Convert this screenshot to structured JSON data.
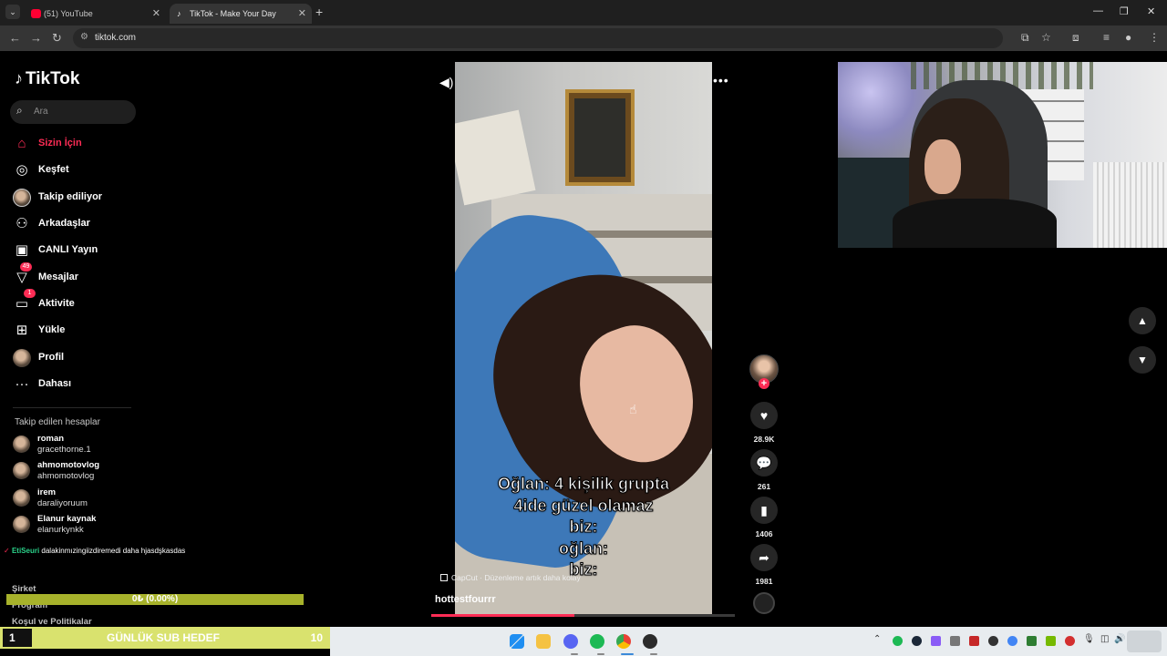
{
  "browser": {
    "tabs": [
      {
        "title": "(51) YouTube",
        "active": false
      },
      {
        "title": "TikTok - Make Your Day",
        "active": true
      }
    ],
    "url": "tiktok.com"
  },
  "sidebar": {
    "logo": "TikTok",
    "search_placeholder": "Ara",
    "nav": [
      {
        "label": "Sizin İçin",
        "icon": "home-icon",
        "active": true
      },
      {
        "label": "Keşfet",
        "icon": "compass-icon"
      },
      {
        "label": "Takip ediliyor",
        "icon": "following-avatar-icon"
      },
      {
        "label": "Arkadaşlar",
        "icon": "friends-icon"
      },
      {
        "label": "CANLI Yayın",
        "icon": "live-icon"
      },
      {
        "label": "Mesajlar",
        "icon": "messages-icon",
        "badge": "49"
      },
      {
        "label": "Aktivite",
        "icon": "activity-icon",
        "badge": "1"
      },
      {
        "label": "Yükle",
        "icon": "upload-icon"
      },
      {
        "label": "Profil",
        "icon": "profile-avatar-icon"
      },
      {
        "label": "Dahası",
        "icon": "more-icon"
      }
    ],
    "following_header": "Takip edilen hesaplar",
    "following": [
      {
        "name": "roman",
        "username": "gracethorne.1"
      },
      {
        "name": "ahmomotovlog",
        "username": "ahmomotovlog"
      },
      {
        "name": "irem",
        "username": "daraliyoruum"
      },
      {
        "name": "Elanur kaynak",
        "username": "elanurkynkk"
      }
    ],
    "footer_links": [
      "Şirket",
      "Program",
      "Koşul ve Politikalar"
    ]
  },
  "stream_overlay": {
    "chat_user": "EtiSeuri",
    "chat_message": "dalakinmızingiizdiremedi daha hjasdşkasdas",
    "progress_text": "0₺ (0.00%)",
    "sub_goal": {
      "current": "1",
      "label": "GÜNLÜK SUB HEDEF",
      "target": "10"
    }
  },
  "video": {
    "caption_lines": [
      "Oğlan: 4 kişilik grupta",
      "4ide güzel olamaz",
      "biz:",
      "oğlan:",
      "biz:"
    ],
    "capcut_label": "CapCut · Düzenleme artık daha kolay",
    "author": "hottestfourrr",
    "progress_fraction": 0.47,
    "likes": "28.9K",
    "comments": "261",
    "saves": "1406",
    "shares": "1981"
  }
}
